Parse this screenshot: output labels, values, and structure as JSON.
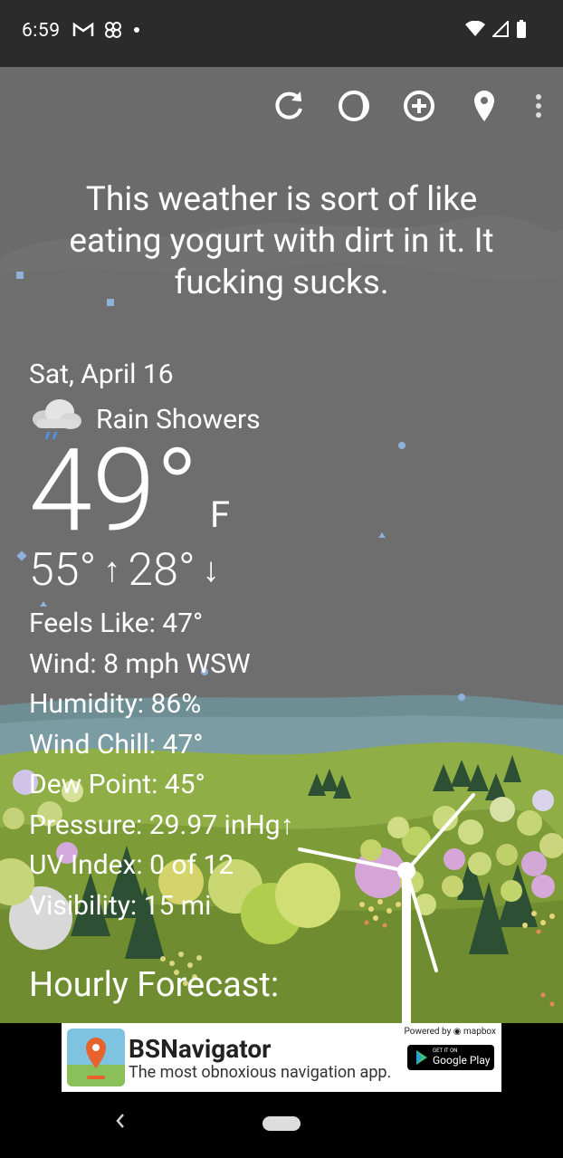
{
  "status_bar": {
    "time": "6:59",
    "left_icons": [
      "gmail-icon",
      "pinwheel-icon",
      "dot-icon"
    ],
    "right_icons": [
      "wifi-icon",
      "cellular-icon",
      "battery-icon"
    ]
  },
  "toolbar": {
    "buttons": [
      "refresh-icon",
      "theme-icon",
      "add-location-icon",
      "location-pin-icon",
      "more-vert-icon"
    ]
  },
  "quote": "This weather is sort of like eating yogurt with dirt in it. It fucking sucks.",
  "weather": {
    "date": "Sat, April 16",
    "condition_icon": "rain-cloud-icon",
    "condition": "Rain Showers",
    "temp": "49°",
    "unit": "F",
    "high": "55°",
    "high_arrow": "↑",
    "low": "28°",
    "low_arrow": "↓",
    "stats": [
      "Feels Like:  47°",
      "Wind:  8 mph WSW",
      "Humidity:  86%",
      "Wind Chill:  47°",
      "Dew Point:  45°",
      "Pressure:  29.97 inHg↑",
      "UV Index:  0 of 12",
      "Visibility:  15 mi"
    ]
  },
  "hourly_title": "Hourly Forecast:",
  "ad": {
    "title": "BSNavigator",
    "subtitle": "The most obnoxious navigation app.",
    "powered_by": "Powered by ◉ mapbox",
    "play_small": "GET IT ON",
    "play_label": "Google Play"
  },
  "colors": {
    "sky": "#6f6f6f",
    "hills_far": "#8a8a8a",
    "water": "#7a9aa0",
    "grass": "#8aa83e",
    "tree_dark": "#2f5a35"
  }
}
